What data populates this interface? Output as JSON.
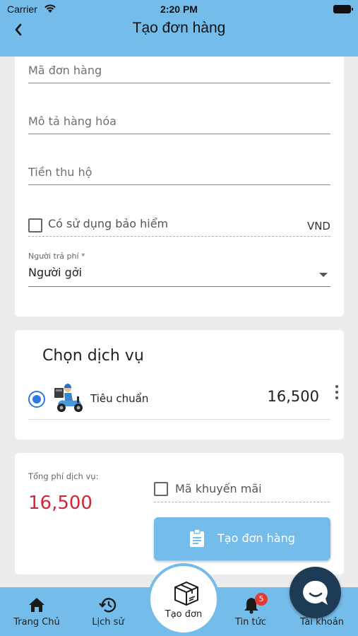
{
  "status_bar": {
    "carrier": "Carrier",
    "time": "2:20 PM"
  },
  "header": {
    "title": "Tạo đơn hàng",
    "back_icon": "chevron-left-icon"
  },
  "order_form": {
    "order_code_placeholder": "Mã đơn hàng",
    "description_placeholder": "Mô tả hàng hóa",
    "cod_placeholder": "Tiền thu hộ",
    "insurance": {
      "label": "Có sử dụng bảo hiểm",
      "unit": "VND",
      "checked": false
    },
    "payer": {
      "label": "Người trả phí *",
      "value": "Người gởi"
    }
  },
  "service": {
    "heading": "Chọn dịch vụ",
    "options": [
      {
        "name": "Tiêu chuẩn",
        "price": "16,500",
        "selected": true,
        "icon": "delivery-scooter-icon"
      }
    ]
  },
  "summary": {
    "fee_label": "Tổng phí dịch vụ:",
    "fee_value": "16,500",
    "promo_label": "Mã khuyến mãi",
    "create_button": "Tạo đơn hàng"
  },
  "bottom_nav": {
    "home": "Trang Chủ",
    "history": "Lịch sử",
    "create": "Tạo đơn",
    "news": "Tin tức",
    "news_badge": "5",
    "account": "Tài khoản"
  },
  "colors": {
    "header": "#74bce9",
    "accent_blue": "#2c7be5",
    "price_red": "#d0283a",
    "chat_fab": "#1e3b56"
  }
}
